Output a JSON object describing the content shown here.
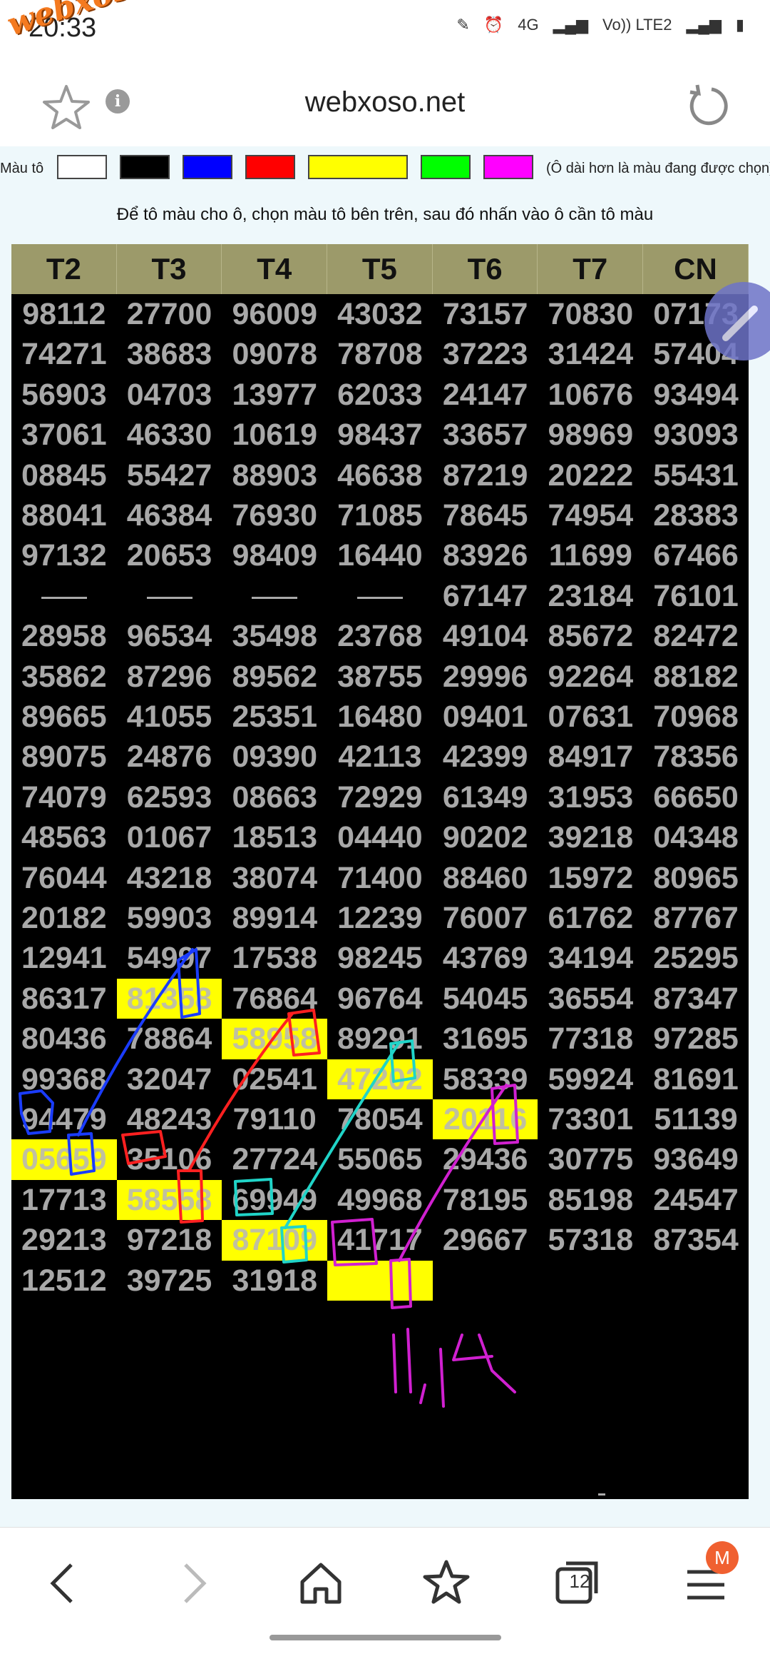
{
  "status_bar": {
    "time": "20:33",
    "network": "4G",
    "carrier": "Vo)) LTE2"
  },
  "watermark": "webxoso.net",
  "browser": {
    "title": "webxoso.net",
    "info_icon": "i"
  },
  "palette": {
    "label": "Màu tô",
    "note": "(Ô dài hơn là màu đang được chọn)",
    "colors": [
      "#ffffff",
      "#000000",
      "#0000ff",
      "#ff0000",
      "#ffff00",
      "#00ff00",
      "#ff00ff"
    ]
  },
  "instruction": "Để tô màu cho ô, chọn màu tô bên trên, sau đó nhấn vào ô cần tô màu",
  "table": {
    "headers": [
      "T2",
      "T3",
      "T4",
      "T5",
      "T6",
      "T7",
      "CN"
    ],
    "rows": [
      [
        "98112",
        "27700",
        "96009",
        "43032",
        "73157",
        "70830",
        "07173"
      ],
      [
        "74271",
        "38683",
        "09078",
        "78708",
        "37223",
        "31424",
        "57404"
      ],
      [
        "56903",
        "04703",
        "13977",
        "62033",
        "24147",
        "10676",
        "93494"
      ],
      [
        "37061",
        "46330",
        "10619",
        "98437",
        "33657",
        "98969",
        "93093"
      ],
      [
        "08845",
        "55427",
        "88903",
        "46638",
        "87219",
        "20222",
        "55431"
      ],
      [
        "88041",
        "46384",
        "76930",
        "71085",
        "78645",
        "74954",
        "28383"
      ],
      [
        "97132",
        "20653",
        "98409",
        "16440",
        "83926",
        "11699",
        "67466"
      ],
      [
        "—",
        "—",
        "—",
        "—",
        "67147",
        "23184",
        "76101"
      ],
      [
        "28958",
        "96534",
        "35498",
        "23768",
        "49104",
        "85672",
        "82472"
      ],
      [
        "35862",
        "87296",
        "89562",
        "38755",
        "29996",
        "92264",
        "88182"
      ],
      [
        "89665",
        "41055",
        "25351",
        "16480",
        "09401",
        "07631",
        "70968"
      ],
      [
        "89075",
        "24876",
        "09390",
        "42113",
        "42399",
        "84917",
        "78356"
      ],
      [
        "74079",
        "62593",
        "08663",
        "72929",
        "61349",
        "31953",
        "66650"
      ],
      [
        "48563",
        "01067",
        "18513",
        "04440",
        "90202",
        "39218",
        "04348"
      ],
      [
        "76044",
        "43218",
        "38074",
        "71400",
        "88460",
        "15972",
        "80965"
      ],
      [
        "20182",
        "59903",
        "89914",
        "12239",
        "76007",
        "61762",
        "87767"
      ],
      [
        "12941",
        "54997",
        "17538",
        "98245",
        "43769",
        "34194",
        "25295"
      ],
      [
        "86317",
        "81358",
        "76864",
        "96764",
        "54045",
        "36554",
        "87347"
      ],
      [
        "80436",
        "78864",
        "58958",
        "89291",
        "31695",
        "77318",
        "97285"
      ],
      [
        "99368",
        "32047",
        "02541",
        "47202",
        "58339",
        "59924",
        "81691"
      ],
      [
        "94479",
        "48243",
        "79110",
        "78054",
        "20116",
        "73301",
        "51139"
      ],
      [
        "05659",
        "35106",
        "27724",
        "55065",
        "29436",
        "30775",
        "93649"
      ],
      [
        "17713",
        "58558",
        "69949",
        "49968",
        "78195",
        "85198",
        "24547"
      ],
      [
        "29213",
        "97218",
        "87109",
        "41717",
        "29667",
        "57318",
        "87354"
      ],
      [
        "12512",
        "39725",
        "31918",
        "",
        "",
        "",
        ""
      ]
    ],
    "highlighted_color": "#ffff00"
  },
  "handwriting": "11,14",
  "bottom_nav": {
    "tabs_count": "12",
    "profile_badge": "M"
  }
}
